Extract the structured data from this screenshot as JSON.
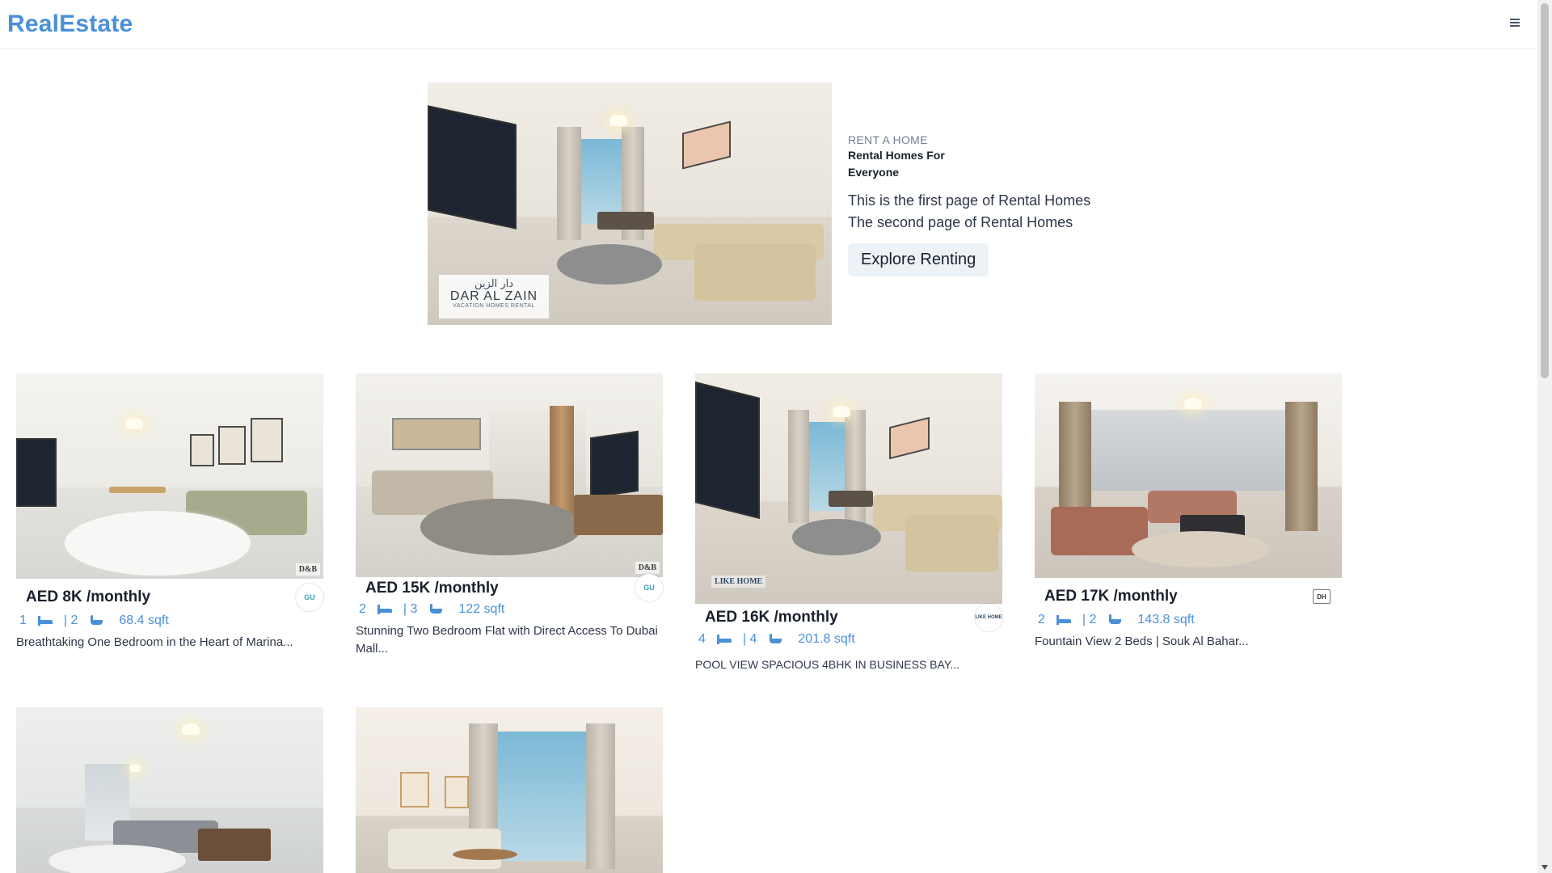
{
  "app": {
    "logo": "RealEstate"
  },
  "hero": {
    "badge_ar": "دار الزين",
    "badge_name": "DAR AL ZAIN",
    "badge_sub": "VACATION HOMES RENTAL",
    "eyebrow": "RENT A HOME",
    "title": "Rental Homes For Everyone",
    "desc1": "This is the first page of Rental Homes",
    "desc2": "The second page of Rental Homes",
    "button": "Explore Renting"
  },
  "listings": [
    {
      "price": "AED 8K /monthly",
      "rooms": "1",
      "baths": "| 2",
      "area": "68.4 sqft",
      "title": "Breathtaking One Bedroom in the Heart of Marina...",
      "agency": "GU",
      "watermark": "D&B"
    },
    {
      "price": "AED 15K /monthly",
      "rooms": "2",
      "baths": "| 3",
      "area": "122 sqft",
      "title": "Stunning Two Bedroom Flat with Direct Access To Dubai Mall...",
      "agency": "GU",
      "watermark": "D&B"
    },
    {
      "price": "AED 16K /monthly",
      "rooms": "4",
      "baths": "| 4",
      "area": "201.8 sqft",
      "title": "POOL VIEW SPACIOUS 4BHK IN BUSINESS BAY...",
      "agency": "LIKE HOME",
      "watermark": "LIKE HOME"
    },
    {
      "price": "AED 17K /monthly",
      "rooms": "2",
      "baths": "| 2",
      "area": "143.8 sqft",
      "title": "Fountain View 2 Beds | Souk Al Bahar...",
      "agency": "DH",
      "watermark": ""
    }
  ],
  "icons": {
    "menu": "hamburger-icon",
    "rooms": "bed-icon",
    "baths": "bath-icon",
    "area": "grid-icon"
  },
  "colors": {
    "accent": "#4a90d9",
    "text": "#1a202c",
    "muted": "#718096"
  }
}
